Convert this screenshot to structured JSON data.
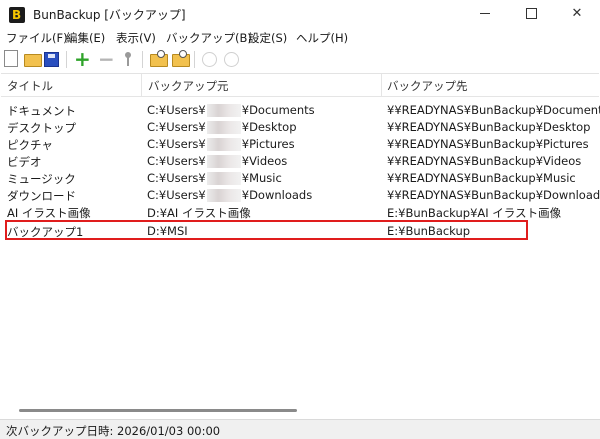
{
  "window": {
    "title": "BunBackup [バックアップ]",
    "controls": {
      "minimize": "",
      "maximize": "",
      "close": "✕"
    }
  },
  "menu": [
    "ファイル(F)",
    "編集(E)",
    "表示(V)",
    "バックアップ(B)",
    "設定(S)",
    "ヘルプ(H)"
  ],
  "toolbar": {
    "icons": [
      "new-icon",
      "open-icon",
      "save-icon",
      "add-icon",
      "remove-icon",
      "properties-icon",
      "backup-icon",
      "backup-all-icon",
      "disabled-icon",
      "disabled-icon"
    ],
    "add": "+",
    "remove": "−"
  },
  "columns": [
    "タイトル",
    "バックアップ元",
    "バックアップ先"
  ],
  "rows": [
    {
      "title": "ドキュメント",
      "src_prefix": "C:¥Users¥",
      "src_suffix": "¥Documents",
      "dest": "¥¥READYNAS¥BunBackup¥Documents"
    },
    {
      "title": "デスクトップ",
      "src_prefix": "C:¥Users¥",
      "src_suffix": "¥Desktop",
      "dest": "¥¥READYNAS¥BunBackup¥Desktop"
    },
    {
      "title": "ピクチャ",
      "src_prefix": "C:¥Users¥",
      "src_suffix": "¥Pictures",
      "dest": "¥¥READYNAS¥BunBackup¥Pictures"
    },
    {
      "title": "ビデオ",
      "src_prefix": "C:¥Users¥",
      "src_suffix": "¥Videos",
      "dest": "¥¥READYNAS¥BunBackup¥Videos"
    },
    {
      "title": "ミュージック",
      "src_prefix": "C:¥Users¥",
      "src_suffix": "¥Music",
      "dest": "¥¥READYNAS¥BunBackup¥Music"
    },
    {
      "title": "ダウンロード",
      "src_prefix": "C:¥Users¥",
      "src_suffix": "¥Downloads",
      "dest": "¥¥READYNAS¥BunBackup¥Downloads"
    },
    {
      "title": "AI イラスト画像",
      "src_prefix": "D:¥AI イラスト画像",
      "src_suffix": "",
      "dest": "E:¥BunBackup¥AI イラスト画像"
    },
    {
      "title": "バックアップ1",
      "src_prefix": "D:¥MSI",
      "src_suffix": "",
      "dest": "E:¥BunBackup"
    }
  ],
  "status": {
    "text": "次バックアップ日時: 2026/01/03 00:00"
  },
  "colors": {
    "highlight": "#e01d1d",
    "add_icon": "#2fa32a",
    "status_bg": "#f0f0f0"
  }
}
